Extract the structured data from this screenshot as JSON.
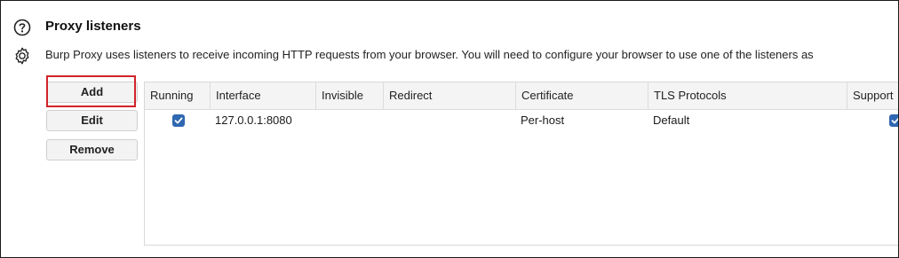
{
  "header": {
    "title": "Proxy listeners",
    "description": "Burp Proxy uses listeners to receive incoming HTTP requests from your browser. You will need to configure your browser to use one of the listeners as"
  },
  "buttons": {
    "add": "Add",
    "edit": "Edit",
    "remove": "Remove"
  },
  "table": {
    "columns": [
      "Running",
      "Interface",
      "Invisible",
      "Redirect",
      "Certificate",
      "TLS Protocols",
      "Support"
    ],
    "rows": [
      {
        "running": true,
        "interface": "127.0.0.1:8080",
        "invisible": "",
        "redirect": "",
        "certificate": "Per-host",
        "tls_protocols": "Default",
        "support": true
      }
    ]
  },
  "colors": {
    "accent": "#2f67b1",
    "highlight": "#d2232a"
  },
  "icons": [
    "help-icon",
    "gear-icon",
    "checkbox-checked-icon"
  ]
}
